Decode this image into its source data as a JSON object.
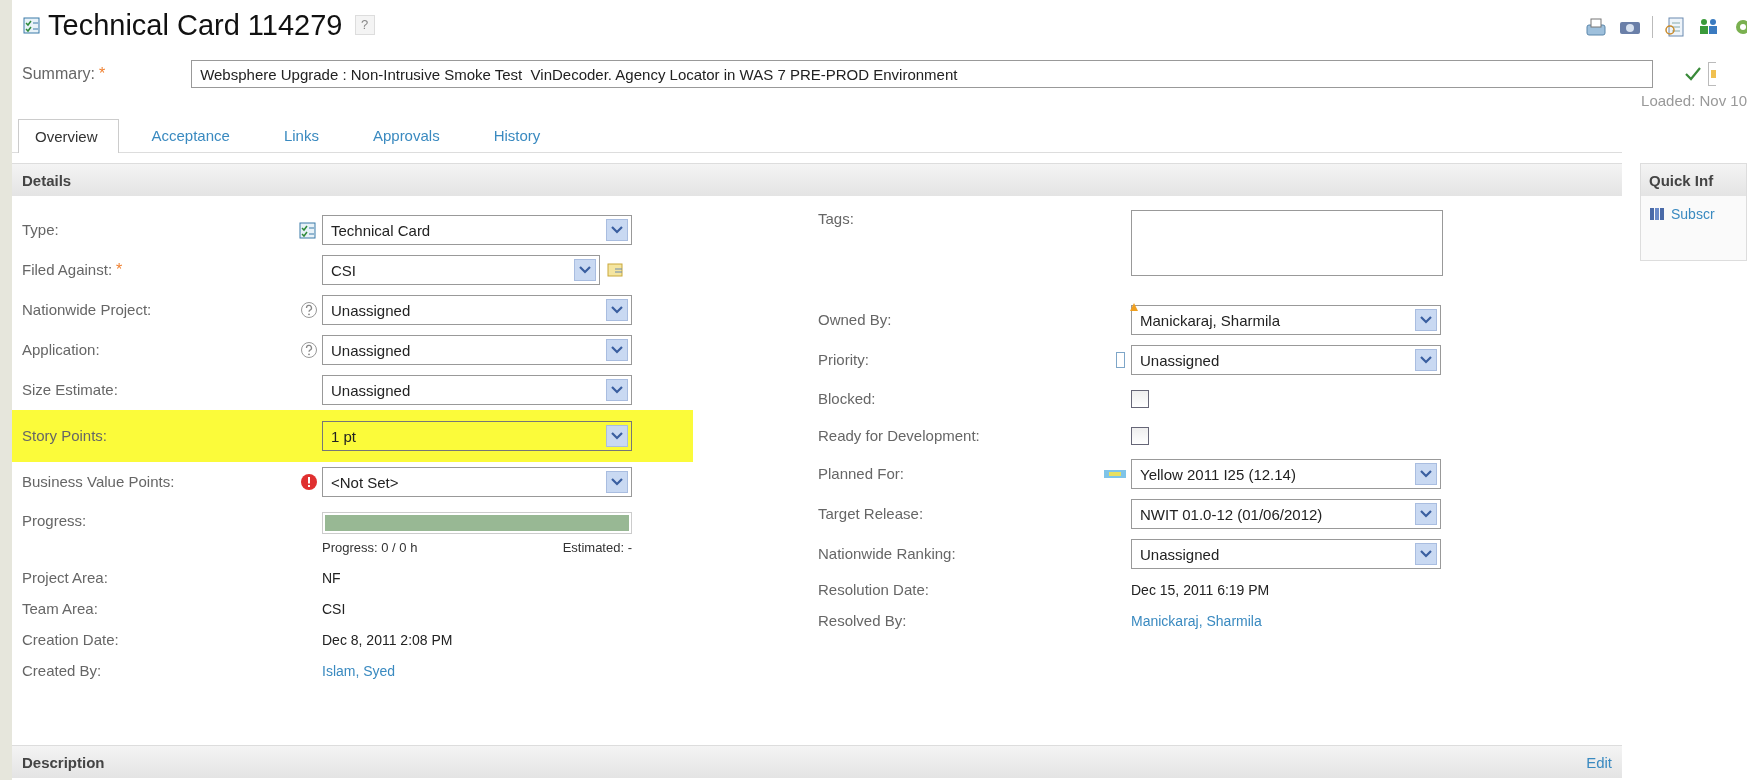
{
  "title": "Technical Card 114279",
  "title_help": "?",
  "summary": {
    "label": "Summary:",
    "required_mark": "*",
    "value": "Websphere Upgrade : Non-Intrusive Smoke Test  VinDecoder. Agency Locator in WAS 7 PRE-PROD Environment"
  },
  "loaded": "Loaded: Nov 10",
  "tabs": [
    {
      "label": "Overview",
      "selected": true
    },
    {
      "label": "Acceptance",
      "selected": false
    },
    {
      "label": "Links",
      "selected": false
    },
    {
      "label": "Approvals",
      "selected": false
    },
    {
      "label": "History",
      "selected": false
    }
  ],
  "details": {
    "title": "Details",
    "left": [
      {
        "label": "Type:",
        "kind": "select",
        "value": "Technical Card",
        "highlighted": false
      },
      {
        "label": "Filed Against:",
        "required_mark": "*",
        "kind": "select",
        "value": "CSI",
        "highlighted": false
      },
      {
        "label": "Nationwide Project:",
        "kind": "select",
        "value": "Unassigned",
        "highlighted": false
      },
      {
        "label": "Application:",
        "kind": "select",
        "value": "Unassigned",
        "highlighted": false
      },
      {
        "label": "Size Estimate:",
        "kind": "select",
        "value": "Unassigned",
        "highlighted": false
      },
      {
        "label": "Story Points:",
        "kind": "select",
        "value": "1 pt",
        "highlighted": true
      },
      {
        "label": "Business Value Points:",
        "kind": "select",
        "value": "<Not Set>",
        "highlighted": false
      },
      {
        "label": "Progress:",
        "kind": "progress",
        "level": 1,
        "progress_text": "Progress: 0 / 0 h",
        "estimate_text": "Estimated: -",
        "highlighted": false
      },
      {
        "label": "Project Area:",
        "kind": "text",
        "value": "NF",
        "highlighted": false
      },
      {
        "label": "Team Area:",
        "kind": "text",
        "value": "CSI",
        "highlighted": false
      },
      {
        "label": "Creation Date:",
        "kind": "text",
        "value": "Dec 8, 2011 2:08 PM",
        "highlighted": false
      },
      {
        "label": "Created By:",
        "kind": "link",
        "value": "Islam, Syed",
        "highlighted": false
      }
    ],
    "right": [
      {
        "label": "Tags:",
        "kind": "textarea"
      },
      {
        "label": "Owned By:",
        "kind": "select",
        "value": "Manickaraj, Sharmila"
      },
      {
        "label": "Priority:",
        "kind": "select",
        "value": "Unassigned"
      },
      {
        "label": "Blocked:",
        "kind": "checkbox",
        "checked": false
      },
      {
        "label": "Ready for Development:",
        "kind": "checkbox",
        "checked": false
      },
      {
        "label": "Planned For:",
        "kind": "select",
        "value": "Yellow 2011 I25 (12.14)"
      },
      {
        "label": "Target Release:",
        "kind": "select",
        "value": "NWIT 01.0-12 (01/06/2012)"
      },
      {
        "label": "Nationwide Ranking:",
        "kind": "select",
        "value": "Unassigned"
      },
      {
        "label": "Resolution Date:",
        "kind": "text",
        "value": "Dec 15, 2011 6:19 PM"
      },
      {
        "label": "Resolved By:",
        "kind": "link",
        "value": "Manickaraj, Sharmila"
      }
    ]
  },
  "quick_info": {
    "title": "Quick Inf",
    "items": [
      "Subscr"
    ]
  },
  "description": {
    "title": "Description",
    "action": "Edit"
  }
}
